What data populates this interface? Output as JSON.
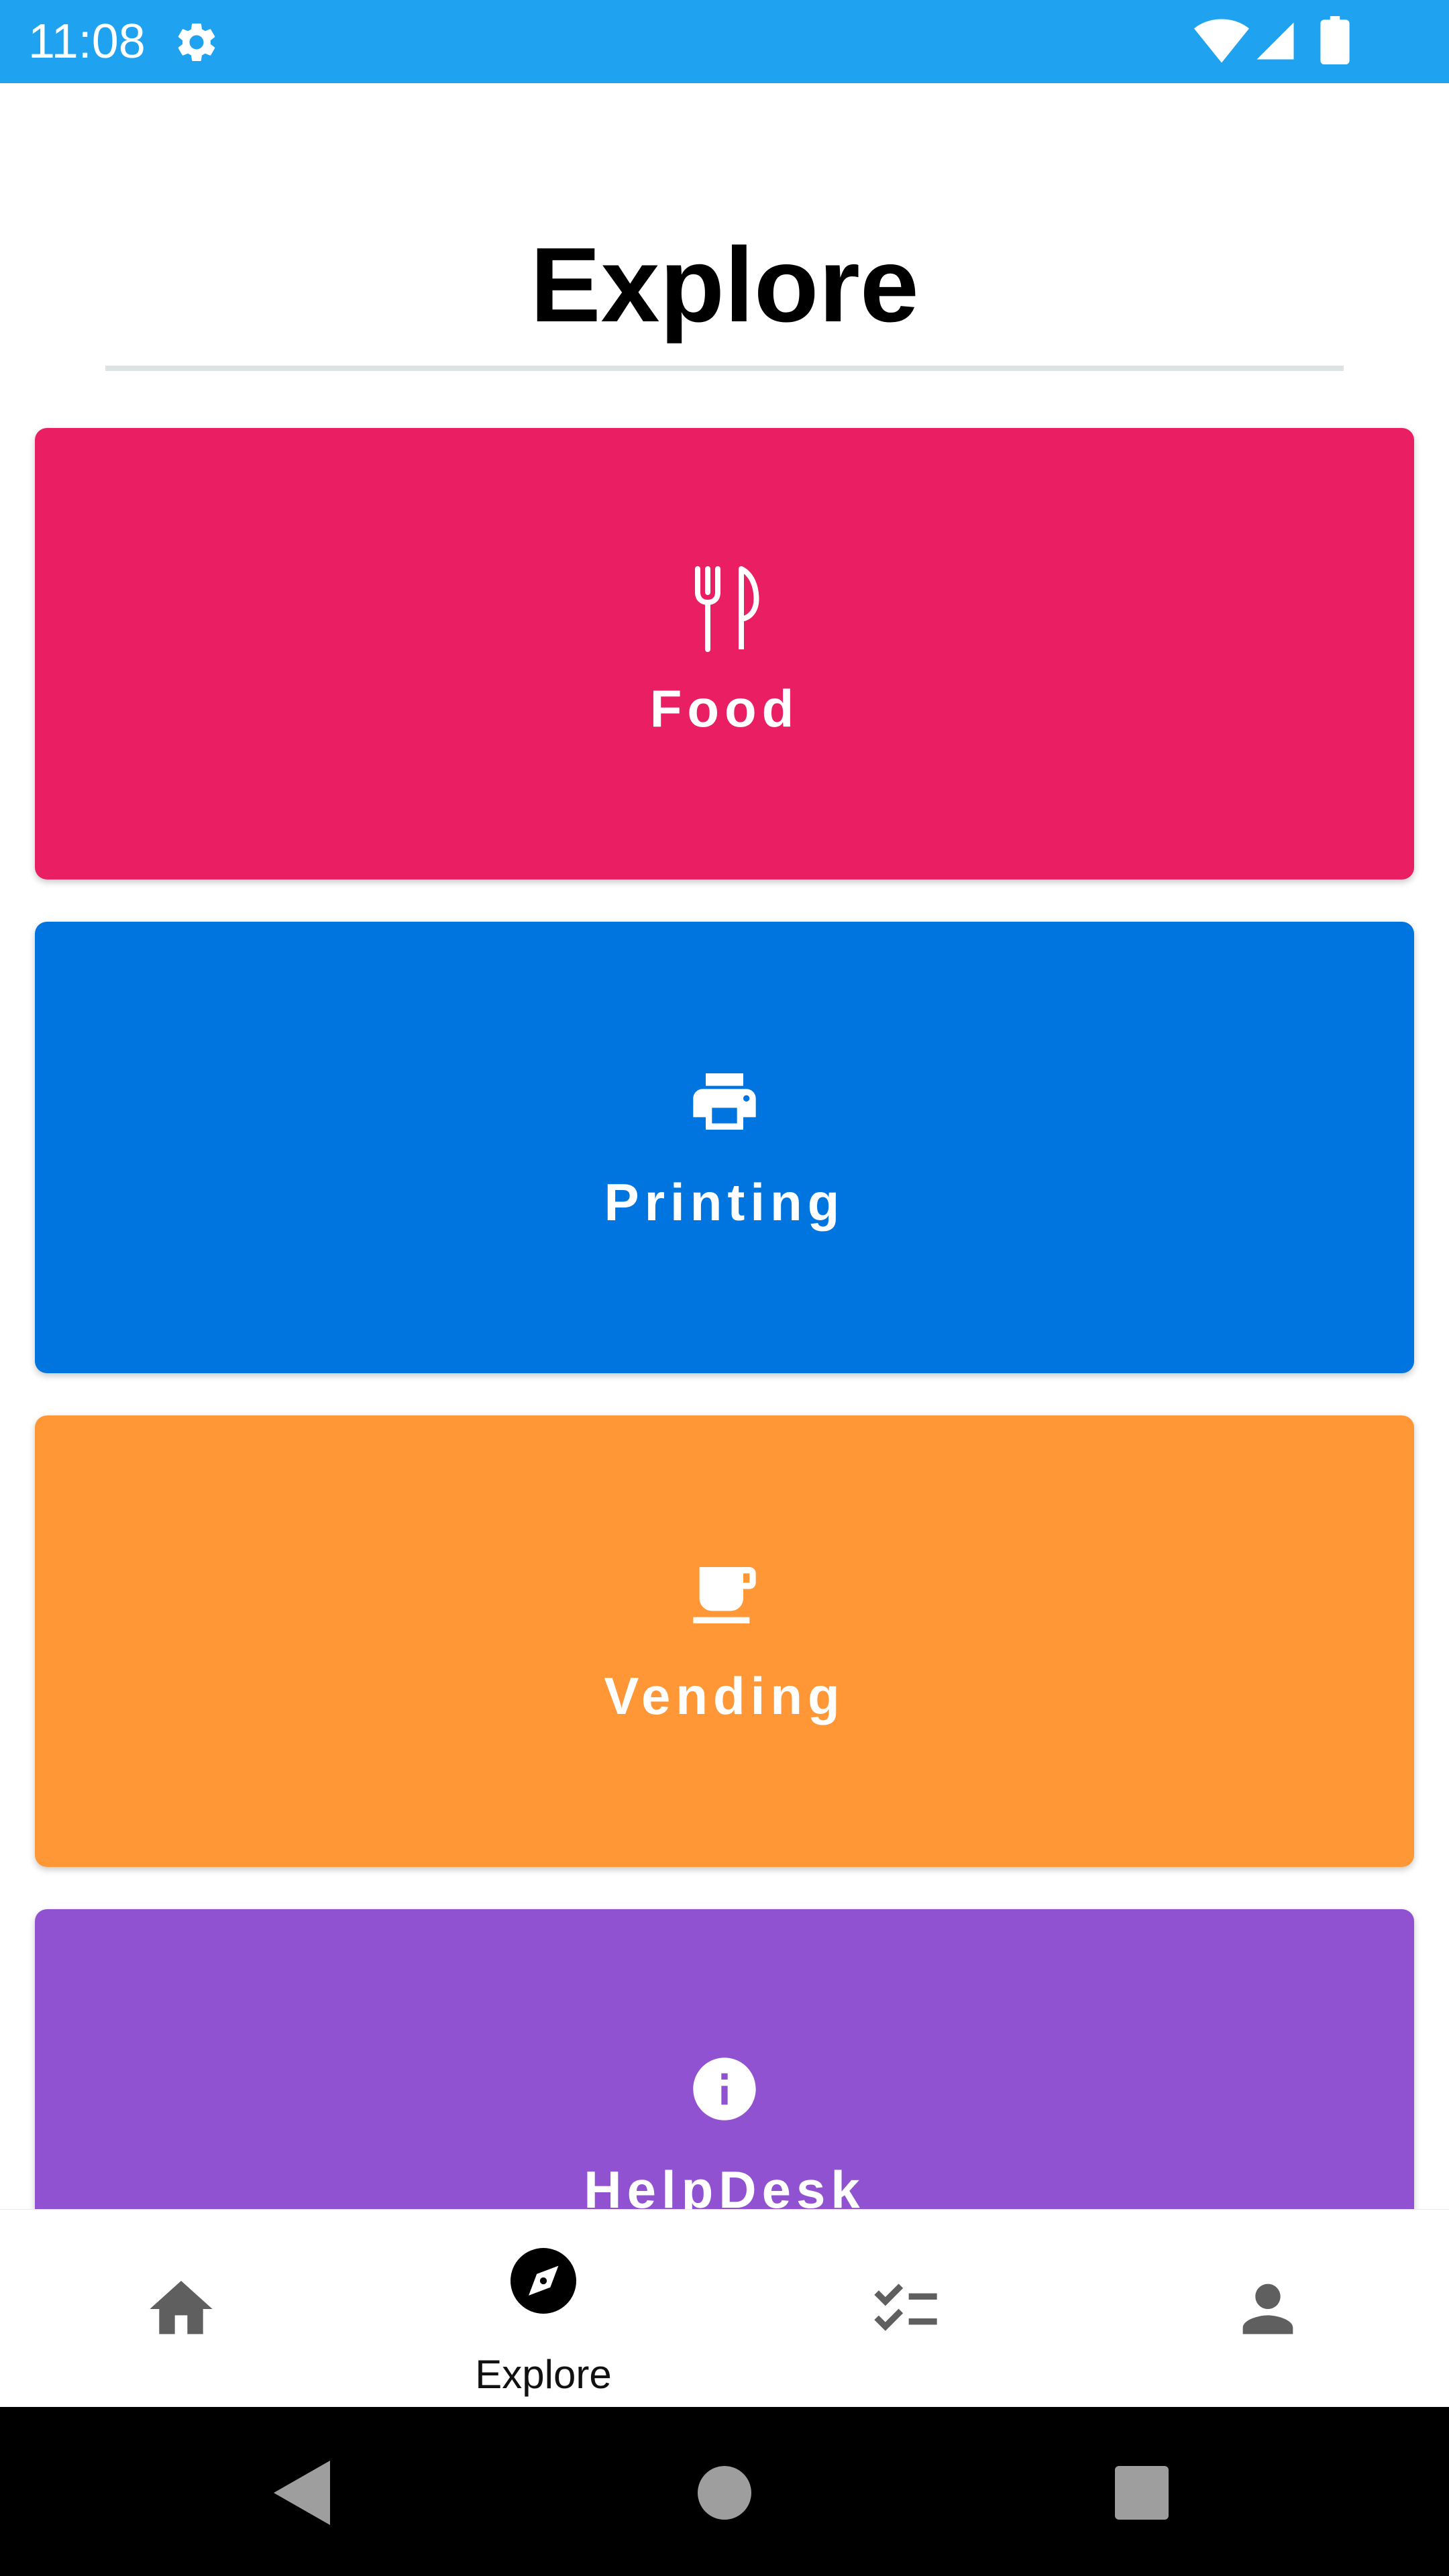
{
  "status_bar": {
    "time": "11:08",
    "background": "#1fa3f0",
    "icons": [
      "settings-icon",
      "wifi-icon",
      "cell-signal-icon",
      "battery-icon"
    ]
  },
  "header": {
    "title": "Explore"
  },
  "cards": [
    {
      "label": "Food",
      "icon": "utensils-icon",
      "color": "#e91e63"
    },
    {
      "label": "Printing",
      "icon": "printer-icon",
      "color": "#0075e0"
    },
    {
      "label": "Vending",
      "icon": "coffee-cup-icon",
      "color": "#ff9737"
    },
    {
      "label": "HelpDesk",
      "icon": "info-icon",
      "color": "#9152d2"
    }
  ],
  "bottom_nav": {
    "items": [
      {
        "id": "home",
        "icon": "home-icon",
        "label": ""
      },
      {
        "id": "explore",
        "icon": "compass-icon",
        "label": "Explore",
        "selected": true
      },
      {
        "id": "tasks",
        "icon": "checklist-icon",
        "label": ""
      },
      {
        "id": "profile",
        "icon": "person-icon",
        "label": ""
      }
    ]
  },
  "system_nav": {
    "buttons": [
      "back-icon",
      "home-circle-icon",
      "recents-icon"
    ]
  }
}
